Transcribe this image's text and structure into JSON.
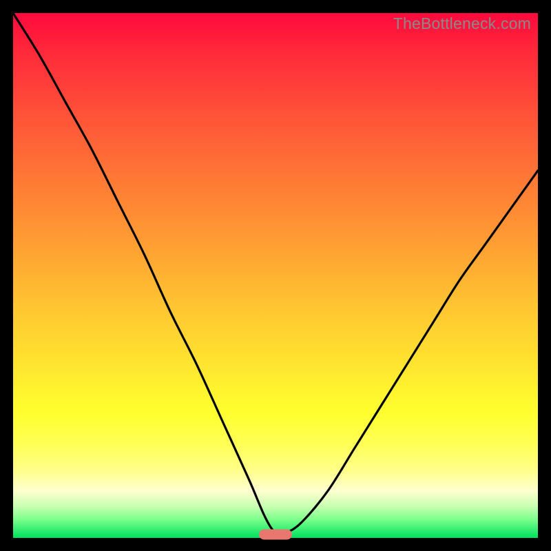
{
  "watermark": "TheBottleneck.com",
  "chart_data": {
    "type": "line",
    "title": "",
    "xlabel": "",
    "ylabel": "",
    "xlim": [
      0,
      100
    ],
    "ylim": [
      0,
      100
    ],
    "grid": false,
    "legend": false,
    "background_gradient": {
      "top_color": "#ff0a3c",
      "bottom_color": "#00e060"
    },
    "series": [
      {
        "name": "bottleneck-curve",
        "color": "#000000",
        "x": [
          0,
          5,
          10,
          15,
          20,
          25,
          30,
          35,
          40,
          45,
          48,
          50,
          52,
          55,
          60,
          65,
          70,
          75,
          80,
          85,
          90,
          95,
          100
        ],
        "y": [
          100,
          92,
          83,
          74,
          64,
          54,
          43,
          33,
          22,
          11,
          4,
          1,
          1,
          3,
          9,
          17,
          25,
          33,
          41,
          49,
          56,
          63,
          70
        ]
      }
    ],
    "marker": {
      "name": "optimal-point",
      "x": 50,
      "y": 0.7,
      "color": "#e7776f"
    }
  }
}
